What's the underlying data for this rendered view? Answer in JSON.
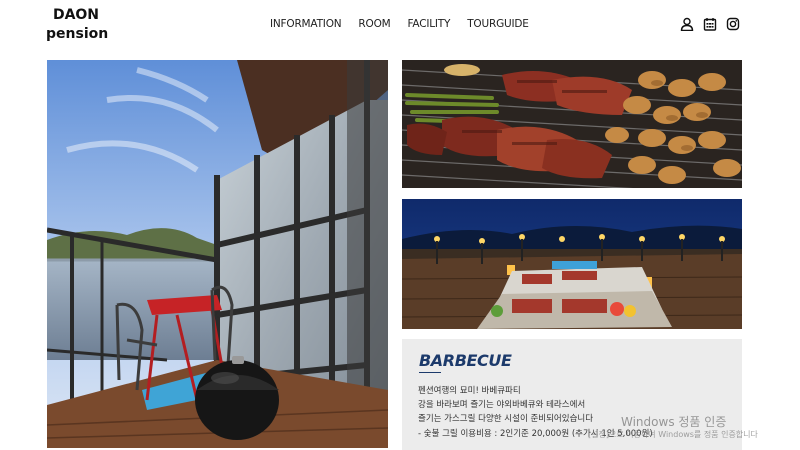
{
  "header": {
    "logo_line1": "DAON",
    "logo_line2": "pension",
    "nav": [
      "INFORMATION",
      "ROOM",
      "FACILITY",
      "TOURGUIDE"
    ],
    "icons": [
      "user-icon",
      "calendar-icon",
      "instagram-icon"
    ]
  },
  "gallery": {
    "left_image": "lake-view-balcony-photo",
    "top_right_image": "grilled-meat-barbecue-photo",
    "middle_right_image": "night-terrace-barbecue-photo"
  },
  "barbecue": {
    "title": "BARBECUE",
    "lines": [
      "펜션여행의 묘미! 바베큐파티",
      "강을 바라보며 즐기는 야외바베큐와 테라스에서",
      "즐기는 가스그릴 다양한 시설이 준비되어있습니다",
      "- 숯불 그릴 이용비용 : 2인기준 20,000원 (추가시 1인 5,000원)"
    ]
  },
  "watermark": {
    "line1": "Windows 정품 인증",
    "line2": "[설정]으로 이동하여 Windows를 정품 인증합니다"
  },
  "colors": {
    "accent": "#1c3a6b",
    "card_bg": "#ececec"
  }
}
